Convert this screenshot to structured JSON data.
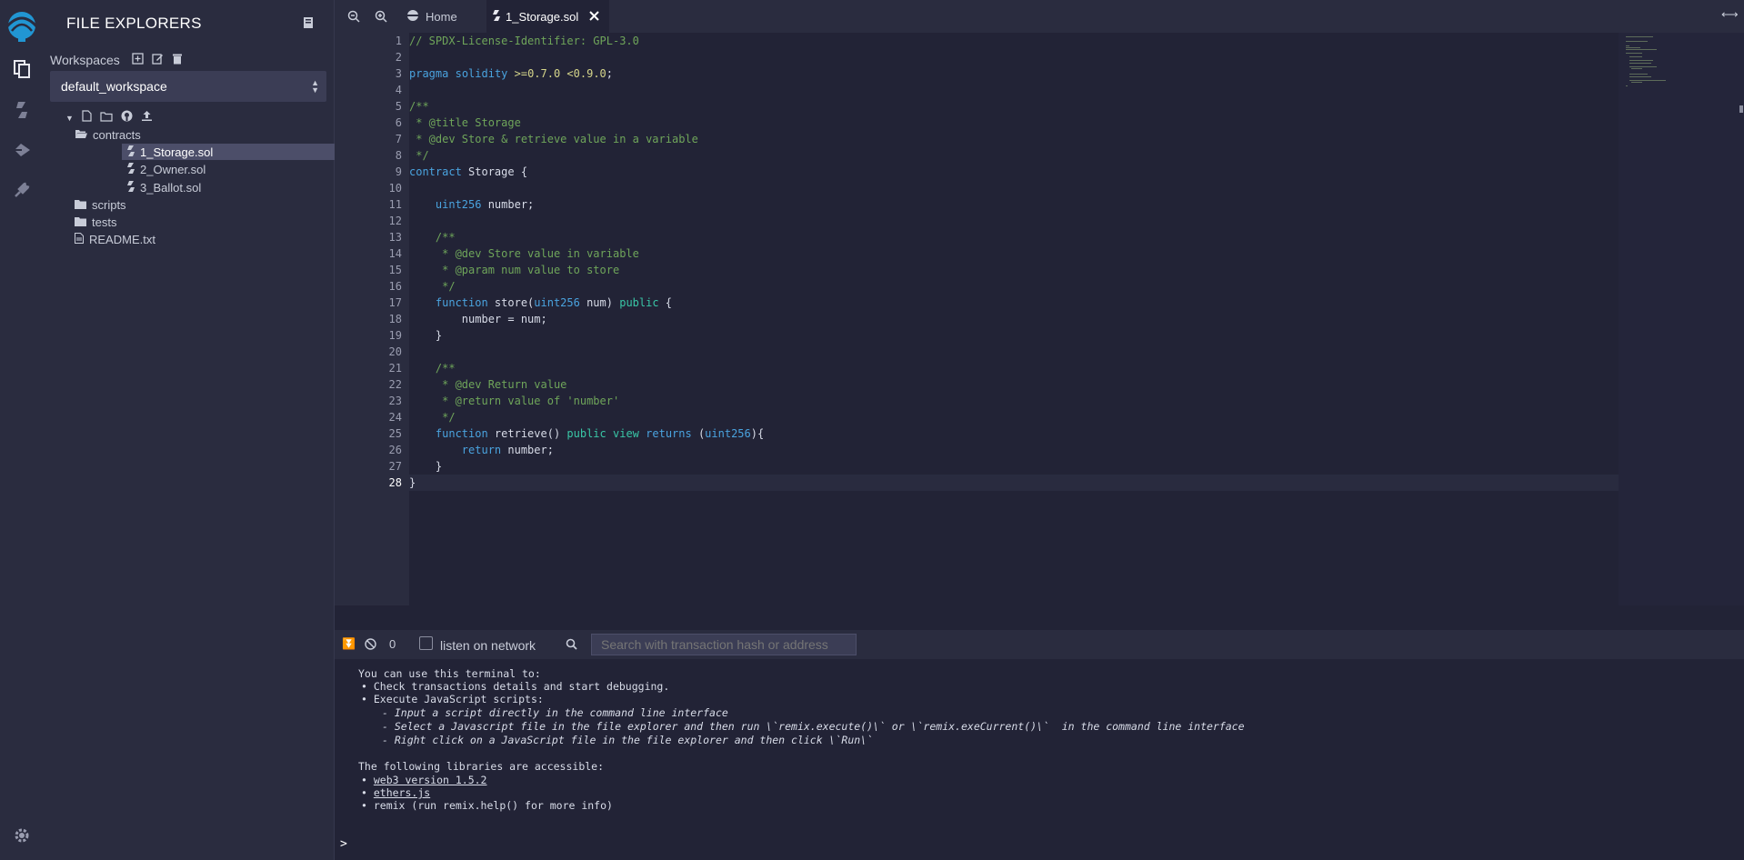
{
  "sidebar": {
    "title": "FILE EXPLORERS",
    "workspaces_label": "Workspaces",
    "workspace_selected": "default_workspace",
    "tree": {
      "folder_contracts": "contracts",
      "files_contracts": [
        "1_Storage.sol",
        "2_Owner.sol",
        "3_Ballot.sol"
      ],
      "folder_scripts": "scripts",
      "folder_tests": "tests",
      "readme": "README.txt"
    }
  },
  "tabs": {
    "home": "Home",
    "file": "1_Storage.sol"
  },
  "editor": {
    "line_numbers": [
      "1",
      "2",
      "3",
      "4",
      "5",
      "6",
      "7",
      "8",
      "9",
      "10",
      "11",
      "12",
      "13",
      "14",
      "15",
      "16",
      "17",
      "18",
      "19",
      "20",
      "21",
      "22",
      "23",
      "24",
      "25",
      "26",
      "27",
      "28"
    ],
    "lines": [
      "// SPDX-License-Identifier: GPL-3.0",
      "",
      "pragma solidity >=0.7.0 <0.9.0;",
      "",
      "/**",
      " * @title Storage",
      " * @dev Store & retrieve value in a variable",
      " */",
      "contract Storage {",
      "",
      "    uint256 number;",
      "",
      "    /**",
      "     * @dev Store value in variable",
      "     * @param num value to store",
      "     */",
      "    function store(uint256 num) public {",
      "        number = num;",
      "    }",
      "",
      "    /**",
      "     * @dev Return value",
      "     * @return value of 'number'",
      "     */",
      "    function retrieve() public view returns (uint256){",
      "        return number;",
      "    }",
      "}"
    ]
  },
  "terminal": {
    "pending_count": "0",
    "listen_label": "listen on network",
    "search_placeholder": "Search with transaction hash or address",
    "intro": "You can use this terminal to:",
    "items": [
      "Check transactions details and start debugging.",
      "Execute JavaScript scripts:"
    ],
    "subitems": [
      "- Input a script directly in the command line interface",
      "- Select a Javascript file in the file explorer and then run \\`remix.execute()\\` or \\`remix.exeCurrent()\\`  in the command line interface",
      "- Right click on a JavaScript file in the file explorer and then click \\`Run\\`"
    ],
    "libs_intro": "The following libraries are accessible:",
    "libs": [
      "web3 version 1.5.2",
      "ethers.js",
      "remix (run remix.help() for more info)"
    ],
    "prompt": ">"
  },
  "colors": {
    "background": "#222336",
    "panel": "#2a2c3f",
    "accent": "#2196d3",
    "comment": "#6fa55a",
    "keyword": "#4aa3df"
  }
}
